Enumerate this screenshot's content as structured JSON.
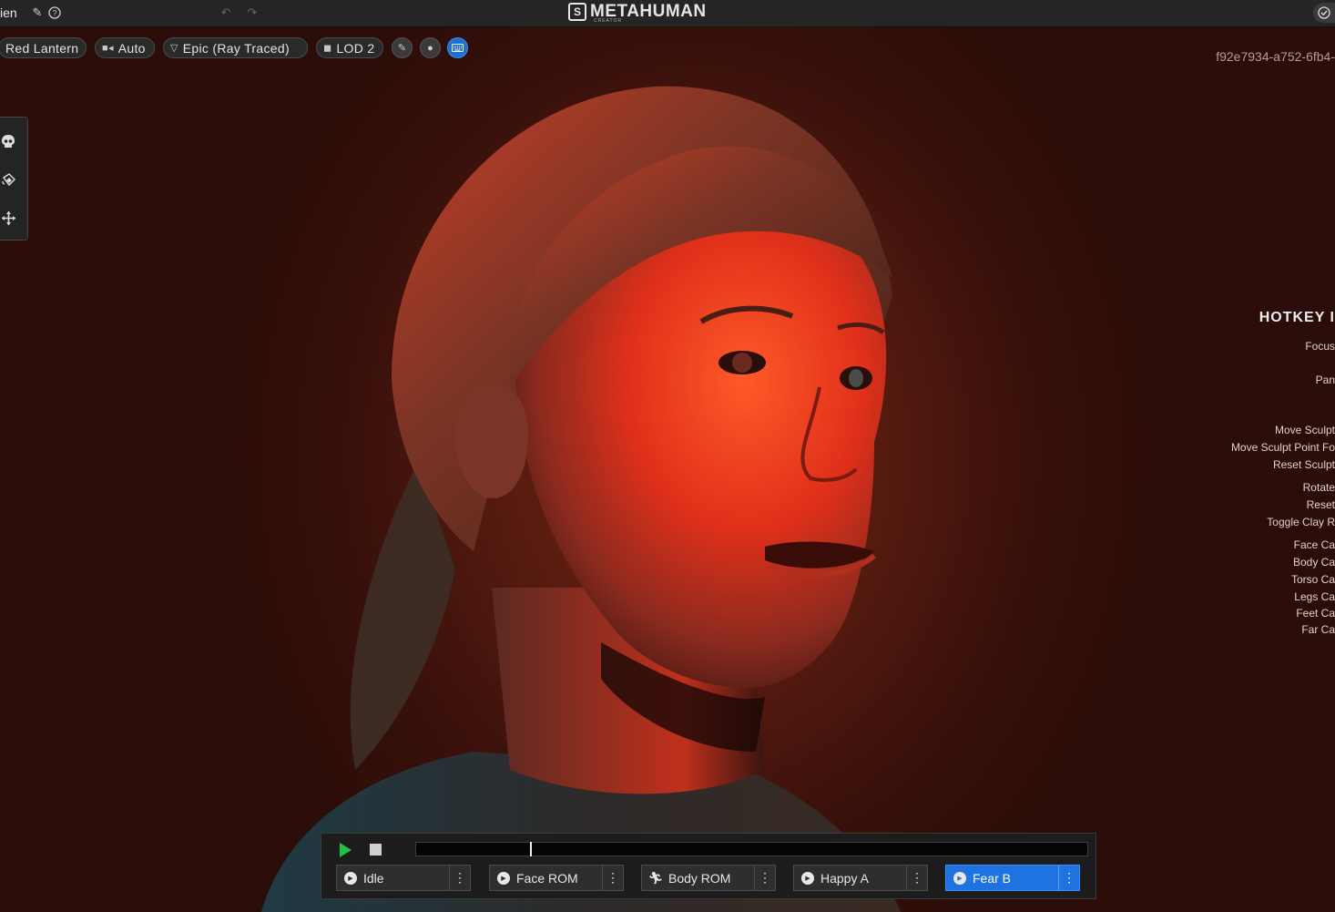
{
  "topbar": {
    "title": "ien",
    "edit_icon": "pencil-icon",
    "help_icon": "question-circle-icon",
    "undo_icon": "undo-icon",
    "redo_icon": "redo-icon",
    "logo_text": "METAHUMAN",
    "logo_subtext": "CREATOR",
    "status_icon": "check-circle-icon"
  },
  "toolbar": {
    "lighting": "Red Lantern",
    "camera": "Auto",
    "quality": "Epic (Ray Traced)",
    "lod": "LOD 2",
    "buttons": [
      "brush-icon",
      "head-icon",
      "keyboard-icon"
    ]
  },
  "viewport": {
    "guid": "f92e7934-a752-6fb4-",
    "accent": "#1f73e0"
  },
  "left_tools": [
    "skull-icon",
    "paint-bucket-icon",
    "move-icon"
  ],
  "hotkeys": {
    "title": "HOTKEY I",
    "items": [
      "Focus",
      "Pan",
      "Move Sculpt",
      "Move Sculpt Point Fo",
      "Reset Sculpt",
      "Rotate",
      "Reset",
      "Toggle Clay R",
      "Face Ca",
      "Body Ca",
      "Torso Ca",
      "Legs Ca",
      "Feet Ca",
      "Far Ca"
    ]
  },
  "player": {
    "progress": 0.17,
    "clips": [
      {
        "label": "Idle",
        "icon": "play-circle-icon",
        "active": false
      },
      {
        "label": "Face ROM",
        "icon": "play-circle-icon",
        "active": false
      },
      {
        "label": "Body ROM",
        "icon": "running-icon",
        "active": false
      },
      {
        "label": "Happy A",
        "icon": "play-circle-icon",
        "active": false
      },
      {
        "label": "Fear B",
        "icon": "play-circle-icon",
        "active": true
      }
    ]
  }
}
